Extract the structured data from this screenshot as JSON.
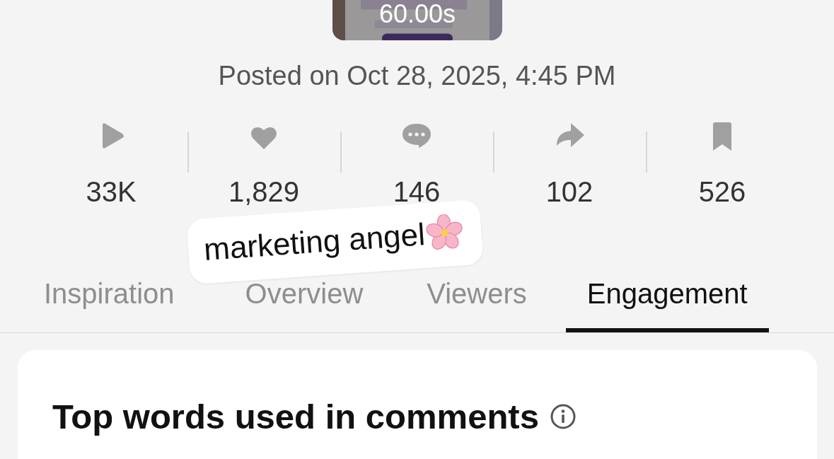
{
  "video": {
    "duration": "60.00s"
  },
  "posted": "Posted on Oct 28, 2025, 4:45 PM",
  "stats": [
    {
      "kind": "play",
      "value": "33K"
    },
    {
      "kind": "like",
      "value": "1,829"
    },
    {
      "kind": "comment",
      "value": "146"
    },
    {
      "kind": "share",
      "value": "102"
    },
    {
      "kind": "save",
      "value": "526"
    }
  ],
  "sticker": {
    "text": "marketing angel"
  },
  "tabs": [
    {
      "label": "Inspiration",
      "selected": false
    },
    {
      "label": "Overview",
      "selected": false
    },
    {
      "label": "Viewers",
      "selected": false
    },
    {
      "label": "Engagement",
      "selected": true
    }
  ],
  "card": {
    "title": "Top words used in comments"
  }
}
